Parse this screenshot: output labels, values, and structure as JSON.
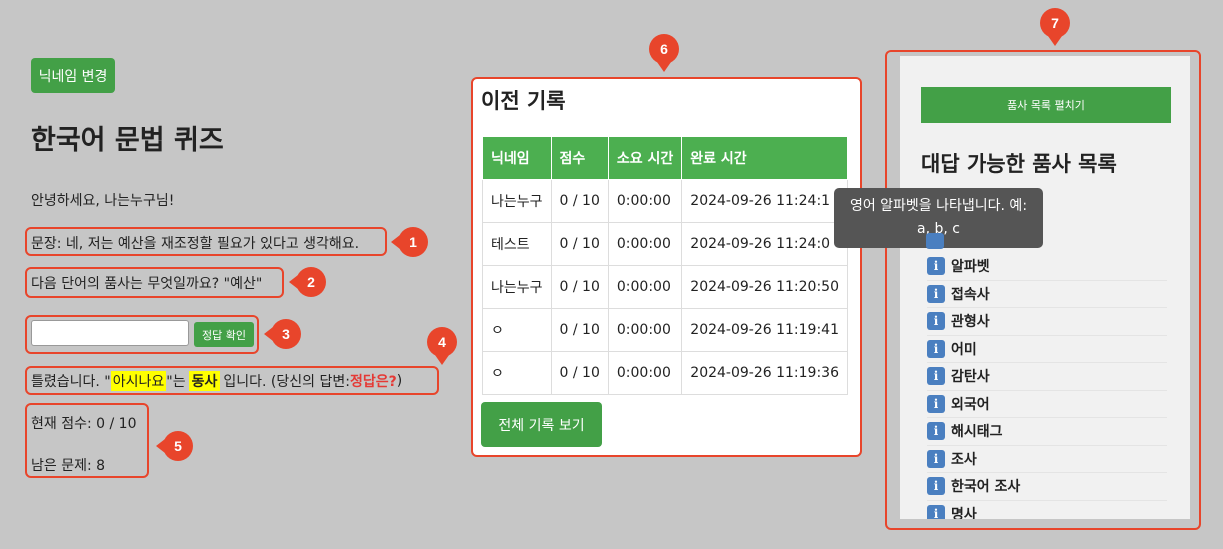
{
  "nickname_button": "닉네임 변경",
  "page_title": "한국어 문법 퀴즈",
  "greeting": "안녕하세요, 나는누구님!",
  "sentence": "문장: 네, 저는 예산을 재조정할 필요가 있다고 생각해요.",
  "question": "다음 단어의 품사는 무엇일까요? \"예산\"",
  "answer_input": {
    "value": "",
    "placeholder": ""
  },
  "check_button": "정답 확인",
  "feedback": {
    "prefix": "틀렸습니다. \"",
    "word": "아시나요",
    "mid": "\"는",
    "pos": "동사",
    "suffix": "입니다. (당신의 답변: ",
    "user_answer": "정답은?",
    "end": ")"
  },
  "score_line": "현재 점수: 0 / 10",
  "remaining_line": "남은 문제: 8",
  "history": {
    "title": "이전 기록",
    "columns": [
      "닉네임",
      "점수",
      "소요 시간",
      "완료 시간"
    ],
    "rows": [
      [
        "나는누구",
        "0 / 10",
        "0:00:00",
        "2024-09-26 11:24:1"
      ],
      [
        "테스트",
        "0 / 10",
        "0:00:00",
        "2024-09-26 11:24:0"
      ],
      [
        "나는누구",
        "0 / 10",
        "0:00:00",
        "2024-09-26 11:20:50"
      ],
      [
        "ㅇ",
        "0 / 10",
        "0:00:00",
        "2024-09-26 11:19:41"
      ],
      [
        "ㅇ",
        "0 / 10",
        "0:00:00",
        "2024-09-26 11:19:36"
      ]
    ],
    "all_button": "전체 기록 보기"
  },
  "pos_panel": {
    "expand_button": "품사 목록 펼치기",
    "title": "대답 가능한 품사 목록",
    "tooltip_line1": "영어 알파벳을 나타냅니다. 예:",
    "tooltip_line2": "a, b, c",
    "items": [
      "알파벳",
      "접속사",
      "관형사",
      "어미",
      "감탄사",
      "외국어",
      "해시태그",
      "조사",
      "한국어 조사",
      "명사"
    ]
  },
  "badges": [
    "1",
    "2",
    "3",
    "4",
    "5",
    "6",
    "7"
  ],
  "colors": {
    "accent": "#e8452b",
    "green": "#43a047",
    "highlight": "#ffff00",
    "wrong": "#e53935"
  }
}
